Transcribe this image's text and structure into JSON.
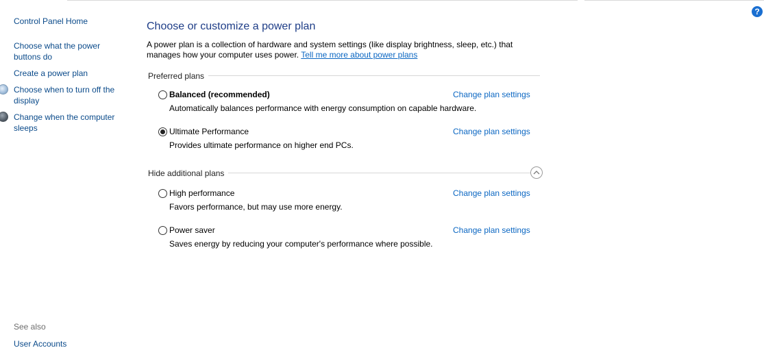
{
  "help": {
    "label": "?"
  },
  "sidebar": {
    "home": "Control Panel Home",
    "items": [
      {
        "label_line1": "Choose what the power",
        "label_line2": "buttons do"
      },
      {
        "label_line1": "Create a power plan"
      },
      {
        "label_line1": "Choose when to turn off the",
        "label_line2": "display",
        "icon": "monitor-icon"
      },
      {
        "label_line1": "Change when the computer",
        "label_line2": "sleeps",
        "icon": "moon-icon"
      }
    ],
    "see_also": "See also",
    "see_also_links": [
      "User Accounts"
    ]
  },
  "main": {
    "title": "Choose or customize a power plan",
    "intro_line1": "A power plan is a collection of hardware and system settings (like display brightness, sleep, etc.) that",
    "intro_line2": "manages how your computer uses power.",
    "intro_link": "Tell me more about power plans",
    "preferred_header": "Preferred plans",
    "hidden_header": "Hide additional plans",
    "change_label": "Change plan settings",
    "plans": [
      {
        "name": "Balanced (recommended)",
        "description": "Automatically balances performance with energy consumption on capable hardware.",
        "selected": false
      },
      {
        "name": "Ultimate Performance",
        "description": "Provides ultimate performance on higher end PCs.",
        "selected": true
      },
      {
        "name": "High performance",
        "description": "Favors performance, but may use more energy.",
        "selected": false
      },
      {
        "name": "Power saver",
        "description": "Saves energy by reducing your computer's performance where possible.",
        "selected": false
      }
    ]
  }
}
